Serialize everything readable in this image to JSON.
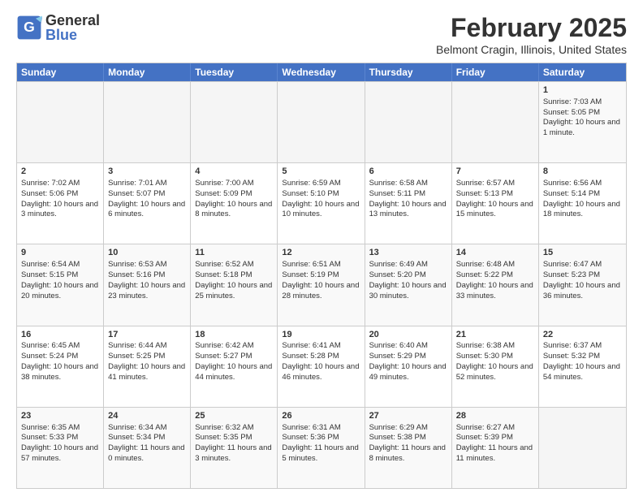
{
  "header": {
    "logo_general": "General",
    "logo_blue": "Blue",
    "month_title": "February 2025",
    "location": "Belmont Cragin, Illinois, United States"
  },
  "days_of_week": [
    "Sunday",
    "Monday",
    "Tuesday",
    "Wednesday",
    "Thursday",
    "Friday",
    "Saturday"
  ],
  "rows": [
    [
      {
        "day": "",
        "empty": true
      },
      {
        "day": "",
        "empty": true
      },
      {
        "day": "",
        "empty": true
      },
      {
        "day": "",
        "empty": true
      },
      {
        "day": "",
        "empty": true
      },
      {
        "day": "",
        "empty": true
      },
      {
        "day": "1",
        "sunrise": "Sunrise: 7:03 AM",
        "sunset": "Sunset: 5:05 PM",
        "daylight": "Daylight: 10 hours and 1 minute."
      }
    ],
    [
      {
        "day": "2",
        "sunrise": "Sunrise: 7:02 AM",
        "sunset": "Sunset: 5:06 PM",
        "daylight": "Daylight: 10 hours and 3 minutes."
      },
      {
        "day": "3",
        "sunrise": "Sunrise: 7:01 AM",
        "sunset": "Sunset: 5:07 PM",
        "daylight": "Daylight: 10 hours and 6 minutes."
      },
      {
        "day": "4",
        "sunrise": "Sunrise: 7:00 AM",
        "sunset": "Sunset: 5:09 PM",
        "daylight": "Daylight: 10 hours and 8 minutes."
      },
      {
        "day": "5",
        "sunrise": "Sunrise: 6:59 AM",
        "sunset": "Sunset: 5:10 PM",
        "daylight": "Daylight: 10 hours and 10 minutes."
      },
      {
        "day": "6",
        "sunrise": "Sunrise: 6:58 AM",
        "sunset": "Sunset: 5:11 PM",
        "daylight": "Daylight: 10 hours and 13 minutes."
      },
      {
        "day": "7",
        "sunrise": "Sunrise: 6:57 AM",
        "sunset": "Sunset: 5:13 PM",
        "daylight": "Daylight: 10 hours and 15 minutes."
      },
      {
        "day": "8",
        "sunrise": "Sunrise: 6:56 AM",
        "sunset": "Sunset: 5:14 PM",
        "daylight": "Daylight: 10 hours and 18 minutes."
      }
    ],
    [
      {
        "day": "9",
        "sunrise": "Sunrise: 6:54 AM",
        "sunset": "Sunset: 5:15 PM",
        "daylight": "Daylight: 10 hours and 20 minutes."
      },
      {
        "day": "10",
        "sunrise": "Sunrise: 6:53 AM",
        "sunset": "Sunset: 5:16 PM",
        "daylight": "Daylight: 10 hours and 23 minutes."
      },
      {
        "day": "11",
        "sunrise": "Sunrise: 6:52 AM",
        "sunset": "Sunset: 5:18 PM",
        "daylight": "Daylight: 10 hours and 25 minutes."
      },
      {
        "day": "12",
        "sunrise": "Sunrise: 6:51 AM",
        "sunset": "Sunset: 5:19 PM",
        "daylight": "Daylight: 10 hours and 28 minutes."
      },
      {
        "day": "13",
        "sunrise": "Sunrise: 6:49 AM",
        "sunset": "Sunset: 5:20 PM",
        "daylight": "Daylight: 10 hours and 30 minutes."
      },
      {
        "day": "14",
        "sunrise": "Sunrise: 6:48 AM",
        "sunset": "Sunset: 5:22 PM",
        "daylight": "Daylight: 10 hours and 33 minutes."
      },
      {
        "day": "15",
        "sunrise": "Sunrise: 6:47 AM",
        "sunset": "Sunset: 5:23 PM",
        "daylight": "Daylight: 10 hours and 36 minutes."
      }
    ],
    [
      {
        "day": "16",
        "sunrise": "Sunrise: 6:45 AM",
        "sunset": "Sunset: 5:24 PM",
        "daylight": "Daylight: 10 hours and 38 minutes."
      },
      {
        "day": "17",
        "sunrise": "Sunrise: 6:44 AM",
        "sunset": "Sunset: 5:25 PM",
        "daylight": "Daylight: 10 hours and 41 minutes."
      },
      {
        "day": "18",
        "sunrise": "Sunrise: 6:42 AM",
        "sunset": "Sunset: 5:27 PM",
        "daylight": "Daylight: 10 hours and 44 minutes."
      },
      {
        "day": "19",
        "sunrise": "Sunrise: 6:41 AM",
        "sunset": "Sunset: 5:28 PM",
        "daylight": "Daylight: 10 hours and 46 minutes."
      },
      {
        "day": "20",
        "sunrise": "Sunrise: 6:40 AM",
        "sunset": "Sunset: 5:29 PM",
        "daylight": "Daylight: 10 hours and 49 minutes."
      },
      {
        "day": "21",
        "sunrise": "Sunrise: 6:38 AM",
        "sunset": "Sunset: 5:30 PM",
        "daylight": "Daylight: 10 hours and 52 minutes."
      },
      {
        "day": "22",
        "sunrise": "Sunrise: 6:37 AM",
        "sunset": "Sunset: 5:32 PM",
        "daylight": "Daylight: 10 hours and 54 minutes."
      }
    ],
    [
      {
        "day": "23",
        "sunrise": "Sunrise: 6:35 AM",
        "sunset": "Sunset: 5:33 PM",
        "daylight": "Daylight: 10 hours and 57 minutes."
      },
      {
        "day": "24",
        "sunrise": "Sunrise: 6:34 AM",
        "sunset": "Sunset: 5:34 PM",
        "daylight": "Daylight: 11 hours and 0 minutes."
      },
      {
        "day": "25",
        "sunrise": "Sunrise: 6:32 AM",
        "sunset": "Sunset: 5:35 PM",
        "daylight": "Daylight: 11 hours and 3 minutes."
      },
      {
        "day": "26",
        "sunrise": "Sunrise: 6:31 AM",
        "sunset": "Sunset: 5:36 PM",
        "daylight": "Daylight: 11 hours and 5 minutes."
      },
      {
        "day": "27",
        "sunrise": "Sunrise: 6:29 AM",
        "sunset": "Sunset: 5:38 PM",
        "daylight": "Daylight: 11 hours and 8 minutes."
      },
      {
        "day": "28",
        "sunrise": "Sunrise: 6:27 AM",
        "sunset": "Sunset: 5:39 PM",
        "daylight": "Daylight: 11 hours and 11 minutes."
      },
      {
        "day": "",
        "empty": true
      }
    ]
  ]
}
